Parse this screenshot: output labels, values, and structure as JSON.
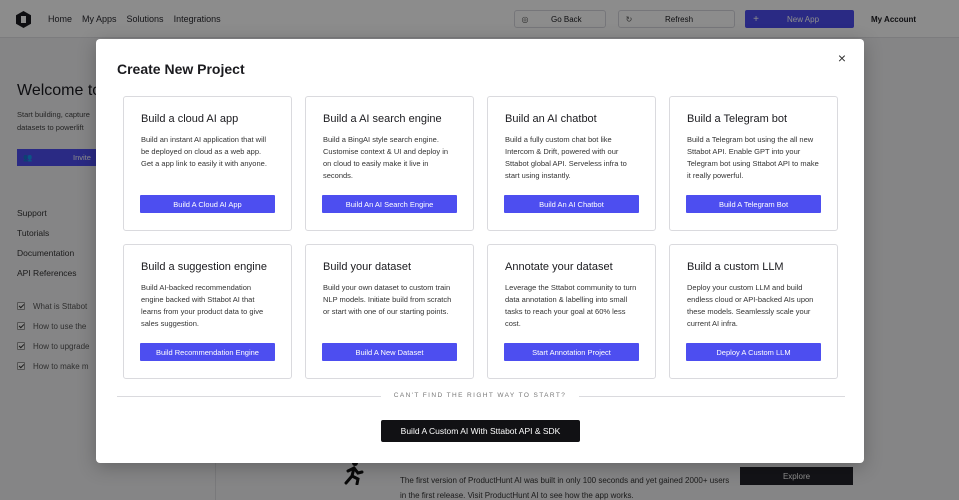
{
  "topbar": {
    "nav": [
      "Home",
      "My Apps",
      "Solutions",
      "Integrations"
    ],
    "go_back": "Go Back",
    "refresh": "Refresh",
    "new_app": "New App",
    "account": "My Account"
  },
  "background": {
    "welcome_title": "Welcome to",
    "welcome_sub": "Start building, capture datasets to powerlift",
    "invite_label": "Invite",
    "side_links": [
      "Support",
      "Tutorials",
      "Documentation",
      "API References"
    ],
    "checklist": [
      "What is Sttabot",
      "How to use the",
      "How to upgrade",
      "How to make m"
    ],
    "producthunt_text": "The first version of ProductHunt AI was built in only 100 seconds and yet gained 2000+ users in the first release. Visit ProductHunt AI to see how the app works.",
    "explore_label": "Explore"
  },
  "modal": {
    "title": "Create New Project",
    "close_symbol": "×",
    "cards": [
      {
        "title": "Build a cloud AI app",
        "desc": "Build an instant AI application that will be deployed on cloud as a web app. Get a app link to easily it with anyone.",
        "button": "Build A Cloud AI App"
      },
      {
        "title": "Build a AI search engine",
        "desc": "Build a BingAI style search engine. Customise context & UI and deploy in on cloud to easily make it live in seconds.",
        "button": "Build An AI Search Engine"
      },
      {
        "title": "Build an AI chatbot",
        "desc": "Build a fully custom chat bot like Intercom & Drift, powered with our Sttabot global API. Serveless infra to start using instantly.",
        "button": "Build An AI Chatbot"
      },
      {
        "title": "Build a Telegram bot",
        "desc": "Build a Telegram bot using the all new Sttabot API. Enable GPT into your Telegram bot using Sttabot API to make it really powerful.",
        "button": "Build A Telegram Bot"
      },
      {
        "title": "Build a suggestion engine",
        "desc": "Build AI-backed recommendation engine backed with Sttabot AI that learns from your product data to give sales suggestion.",
        "button": "Build Recommendation Engine"
      },
      {
        "title": "Build your dataset",
        "desc": "Build your own dataset to custom train NLP models. Initiate build from scratch or start with one of our starting points.",
        "button": "Build A New Dataset"
      },
      {
        "title": "Annotate your dataset",
        "desc": "Leverage the Sttabot community to turn  data annotation & labelling into small tasks to reach your goal at 60% less cost.",
        "button": "Start Annotation Project"
      },
      {
        "title": "Build a custom LLM",
        "desc": "Deploy your custom LLM and build endless cloud or API-backed AIs upon these models. Seamlessly scale your current AI infra.",
        "button": "Deploy A Custom LLM"
      }
    ],
    "divider_text": "CAN'T FIND THE RIGHT WAY TO START?",
    "custom_button": "Build A Custom AI With Sttabot API & SDK"
  },
  "colors": {
    "accent": "#4d4ef0",
    "dark_button": "#111114",
    "overlay": "rgba(0,0,0,0.45)"
  }
}
